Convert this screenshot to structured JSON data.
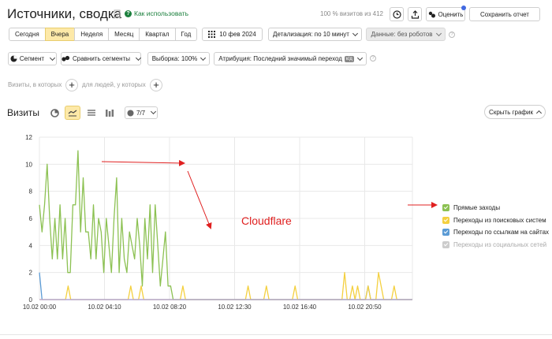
{
  "header": {
    "title": "Источники, сводка",
    "howto": "Как использовать",
    "visits_pct": "100 % визитов из 412",
    "rate_label": "Оценить",
    "save_label": "Сохранить отчет"
  },
  "periods": [
    "Сегодня",
    "Вчера",
    "Неделя",
    "Месяц",
    "Квартал",
    "Год"
  ],
  "active_period": "Вчера",
  "date_label": "10 фев 2024",
  "detail_label": "Детализация: по 10 минут",
  "data_label": "Данные: без роботов",
  "toolbar2": {
    "segment": "Сегмент",
    "compare": "Сравнить сегменты",
    "sample": "Выборка: 100%",
    "attribution": "Атрибуция: Последний значимый переход",
    "attribution_badge": "к/д"
  },
  "filters": {
    "visits_label": "Визиты, в которых",
    "people_label": "для людей, у которых"
  },
  "chart_header": {
    "title": "Визиты",
    "metrics_count": "7/7",
    "hide_label": "Скрыть график"
  },
  "annotation": "Cloudflare",
  "colors": {
    "direct": "#8cc152",
    "search": "#f4d03f",
    "links": "#5b9bd5",
    "social": "#c8c8c8",
    "annotation": "#e02020",
    "accent": "#fde9a8"
  },
  "chart_data": {
    "type": "line",
    "ylim": [
      0,
      12
    ],
    "yticks": [
      0,
      2,
      4,
      6,
      8,
      10,
      12
    ],
    "xtick_labels": [
      "10.02 00:00",
      "10.02 04:10",
      "10.02 08:20",
      "10.02 12:30",
      "10.02 16:40",
      "10.02 20:50"
    ],
    "series": [
      {
        "name": "Прямые заходы",
        "enabled": true,
        "color": "#8cc152",
        "values": [
          7,
          5,
          7,
          10,
          6,
          3,
          6,
          3,
          7,
          3,
          6,
          2,
          2,
          7,
          7,
          11,
          5,
          9,
          5,
          5,
          3,
          7,
          3,
          6,
          5,
          2,
          6,
          4,
          2,
          6,
          9,
          2,
          6,
          3,
          2,
          5,
          4,
          3,
          6,
          4,
          1,
          6,
          3,
          7,
          2,
          7,
          4,
          1,
          3,
          5,
          1,
          1,
          0,
          0,
          0,
          0,
          0,
          0,
          0,
          0,
          0,
          0,
          0,
          0,
          0,
          0,
          0,
          0,
          0,
          0,
          0,
          0,
          0,
          0,
          0,
          0,
          0,
          0,
          0,
          0,
          0,
          0,
          0,
          0,
          0,
          0,
          0,
          0,
          0,
          0,
          0,
          0,
          0,
          0,
          0,
          0,
          0,
          0,
          0,
          0,
          0,
          0,
          0,
          0,
          0,
          0,
          0,
          0,
          0,
          0,
          0,
          0,
          0,
          0,
          0,
          0,
          0,
          0,
          0,
          0,
          0,
          0,
          0,
          0,
          0,
          0,
          0,
          0,
          0,
          0,
          0,
          0,
          0,
          0,
          0,
          0,
          0,
          0,
          0,
          0,
          0,
          0,
          0,
          0,
          0,
          0
        ]
      },
      {
        "name": "Переходы из поисковых систем",
        "enabled": true,
        "color": "#f4d03f",
        "values": [
          0,
          0,
          0,
          0,
          0,
          0,
          0,
          0,
          0,
          0,
          0,
          1,
          0,
          0,
          0,
          0,
          0,
          0,
          0,
          0,
          0,
          0,
          0,
          0,
          0,
          0,
          0,
          0,
          0,
          0,
          0,
          0,
          0,
          0,
          0,
          1,
          0,
          0,
          0,
          1,
          0,
          0,
          0,
          0,
          0,
          0,
          0,
          0,
          0,
          0,
          0,
          0,
          0,
          0,
          0,
          1,
          0,
          0,
          0,
          0,
          0,
          0,
          0,
          0,
          0,
          0,
          0,
          0,
          0,
          0,
          0,
          0,
          0,
          0,
          0,
          0,
          0,
          0,
          0,
          0,
          1,
          0,
          0,
          0,
          0,
          0,
          0,
          1,
          0,
          0,
          0,
          0,
          0,
          0,
          0,
          0,
          0,
          0,
          1,
          0,
          0,
          0,
          0,
          0,
          0,
          0,
          0,
          0,
          0,
          0,
          0,
          0,
          0,
          0,
          0,
          0,
          0,
          2,
          0,
          0,
          1,
          0,
          1,
          0,
          0,
          0,
          1,
          0,
          0,
          0,
          2,
          1,
          0,
          0,
          0,
          0,
          1,
          0,
          0,
          0,
          0,
          0,
          0,
          0
        ]
      },
      {
        "name": "Переходы по ссылкам на сайтах",
        "enabled": true,
        "color": "#5b9bd5",
        "values": [
          2,
          0,
          0,
          0,
          0,
          0,
          0,
          0,
          0,
          0,
          0,
          0,
          0,
          0,
          0,
          0,
          0,
          0,
          0,
          0,
          0,
          0,
          0,
          0,
          0,
          0,
          0,
          0,
          0,
          0,
          0,
          0,
          0,
          0,
          0,
          0,
          0,
          0,
          0,
          0,
          0,
          0,
          0,
          0,
          0,
          0,
          0,
          0,
          0,
          0,
          0,
          0,
          0,
          0,
          0,
          0,
          0,
          0,
          0,
          0,
          0,
          0,
          0,
          0,
          0,
          0,
          0,
          0,
          0,
          0,
          0,
          0,
          0,
          0,
          0,
          0,
          0,
          0,
          0,
          0,
          0,
          0,
          0,
          0,
          0,
          0,
          0,
          0,
          0,
          0,
          0,
          0,
          0,
          0,
          0,
          0,
          0,
          0,
          0,
          0,
          0,
          0,
          0,
          0,
          0,
          0,
          0,
          0,
          0,
          0,
          0,
          0,
          0,
          0,
          0,
          0,
          0,
          0,
          0,
          0,
          0,
          0,
          0,
          0,
          0,
          0,
          1,
          0,
          0,
          0,
          0,
          0,
          0,
          0,
          0,
          0,
          0,
          0,
          0,
          0,
          0,
          0,
          0,
          0
        ]
      },
      {
        "name": "Переходы из социальных сетей",
        "enabled": false,
        "color": "#c8c8c8",
        "values": []
      }
    ]
  }
}
